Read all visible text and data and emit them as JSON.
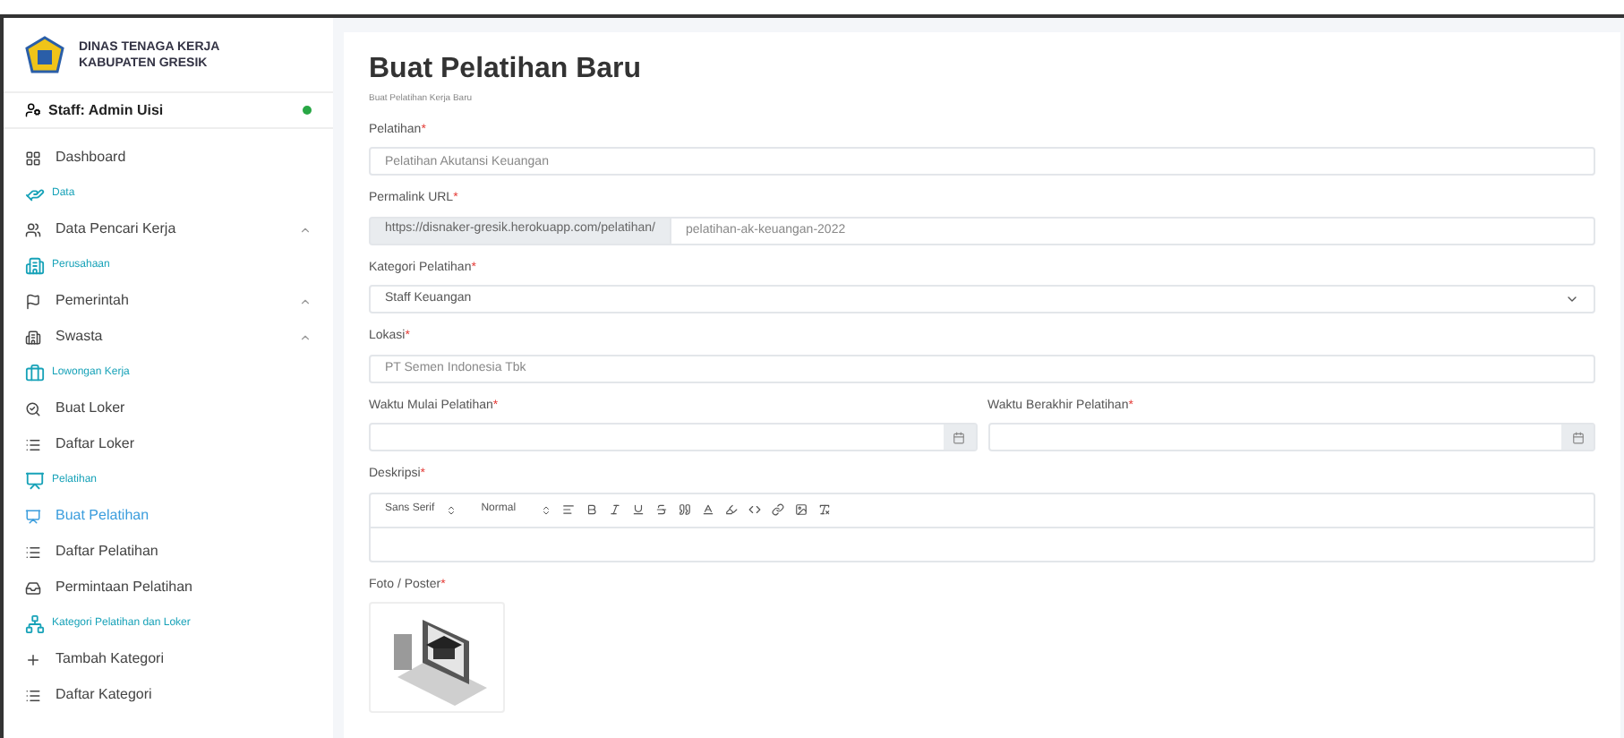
{
  "sidebar": {
    "org_name": [
      "DINAS TENAGA KERJA",
      "KABUPATEN GRESIK"
    ],
    "user": {
      "label": "Staff: Admin Uisi",
      "online": true
    },
    "items": [
      {
        "kind": "link",
        "label": "Dashboard",
        "selected": false
      },
      {
        "kind": "section",
        "label": "Data"
      },
      {
        "kind": "group",
        "label": "Data Pencari Kerja",
        "selected": false
      },
      {
        "kind": "section",
        "label": "Perusahaan"
      },
      {
        "kind": "group",
        "label": "Pemerintah",
        "selected": false
      },
      {
        "kind": "group",
        "label": "Swasta",
        "selected": false
      },
      {
        "kind": "section",
        "label": "Lowongan Kerja"
      },
      {
        "kind": "link",
        "label": "Buat Loker",
        "selected": false
      },
      {
        "kind": "link",
        "label": "Daftar Loker",
        "selected": false
      },
      {
        "kind": "section",
        "label": "Pelatihan"
      },
      {
        "kind": "link",
        "label": "Buat Pelatihan",
        "selected": true
      },
      {
        "kind": "link",
        "label": "Daftar Pelatihan",
        "selected": false
      },
      {
        "kind": "link",
        "label": "Permintaan Pelatihan",
        "selected": false
      },
      {
        "kind": "section",
        "label": "Kategori Pelatihan dan Loker"
      },
      {
        "kind": "link",
        "label": "Tambah Kategori",
        "selected": false
      },
      {
        "kind": "link",
        "label": "Daftar Kategori",
        "selected": false
      }
    ]
  },
  "page": {
    "title": "Buat Pelatihan Baru",
    "subtitle": "Buat Pelatihan Kerja Baru",
    "required_mark": "*",
    "fields": [
      {
        "kind": "text",
        "label": "Pelatihan",
        "placeholder": "Pelatihan Akutansi Keuangan"
      },
      {
        "kind": "url",
        "label": "Permalink URL",
        "prefix": "https://disnaker-gresik.herokuapp.com/pelatihan/",
        "placeholder": "pelatihan-ak-keuangan-2022"
      },
      {
        "kind": "select",
        "label": "Kategori Pelatihan",
        "value": "Staff Keuangan"
      },
      {
        "kind": "text",
        "label": "Lokasi",
        "placeholder": "PT Semen Indonesia Tbk"
      },
      {
        "kind": "dates",
        "label": "Waktu Mulai Pelatihan",
        "label_2": "Waktu Berakhir Pelatihan"
      },
      {
        "kind": "editor",
        "label": "Deskripsi",
        "font": "Sans Serif",
        "size": "Normal"
      },
      {
        "kind": "image",
        "label": "Foto / Poster"
      }
    ]
  }
}
